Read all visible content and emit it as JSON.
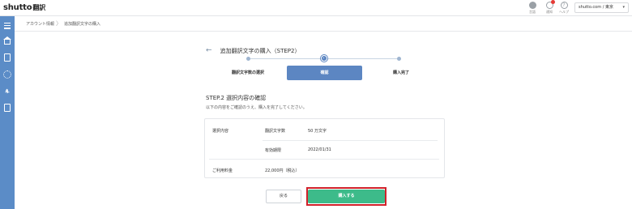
{
  "app": {
    "logo_text": "shutto",
    "logo_kana": "翻訳"
  },
  "topbar": {
    "icons": [
      {
        "name": "globe-icon",
        "label": "言語"
      },
      {
        "name": "bell-icon",
        "label": "通知"
      },
      {
        "name": "help-icon",
        "label": "ヘルプ"
      }
    ],
    "account_select": "shutto.com / 東京",
    "account_caret": "▾"
  },
  "sidebar": {
    "items": [
      {
        "name": "menu-icon"
      },
      {
        "name": "home-icon"
      },
      {
        "name": "document-icon"
      },
      {
        "name": "gear-icon"
      },
      {
        "name": "users-icon"
      },
      {
        "name": "file-icon"
      }
    ]
  },
  "breadcrumb": {
    "items": [
      "アカウント情報",
      "追加翻訳文字の購入"
    ],
    "separator": "〉"
  },
  "page": {
    "back_arrow": "←",
    "title": "追加翻訳文字の購入（STEP2）"
  },
  "stepper": {
    "steps": [
      {
        "label": "翻訳文字数の選択",
        "active": false
      },
      {
        "label": "確認",
        "active": true
      },
      {
        "label": "購入完了",
        "active": false
      }
    ]
  },
  "section": {
    "title": "STEP.2 選択内容の確認",
    "description": "以下の内容をご確認のうえ、購入を完了してください。"
  },
  "details": {
    "selection_label": "選択内容",
    "rows": [
      {
        "key": "翻訳文字数",
        "value": "50 万文字"
      },
      {
        "key": "有効期限",
        "value": "2022/01/31"
      }
    ],
    "price_label": "ご利用料金",
    "price_value": "22,000円（税込）"
  },
  "buttons": {
    "back": "戻る",
    "buy": "購入する"
  },
  "colors": {
    "sidebar": "#5b8cc7",
    "accent": "#5c86c2",
    "buy": "#3dbb8a",
    "highlight": "#d0212a"
  }
}
